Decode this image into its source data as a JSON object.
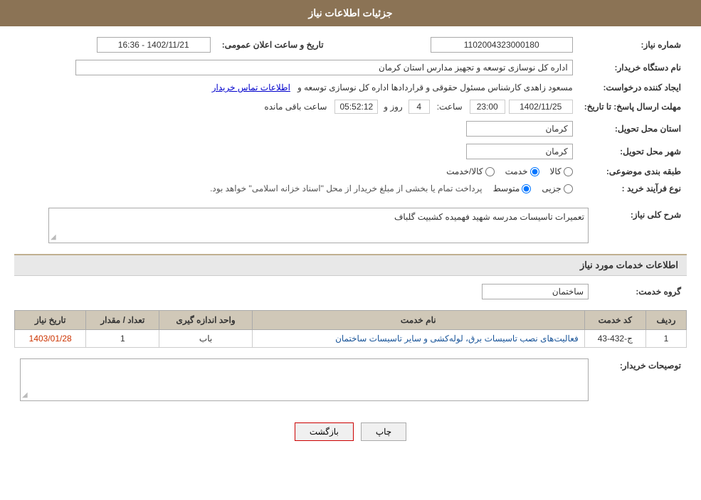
{
  "header": {
    "title": "جزئیات اطلاعات نیاز"
  },
  "fields": {
    "shomareNiaz_label": "شماره نیاز:",
    "shomareNiaz_value": "1102004323000180",
    "namDastgah_label": "نام دستگاه خریدار:",
    "namDastgah_value": "اداره کل نوسازی  توسعه و تجهیز مدارس استان کرمان",
    "ijadKonande_label": "ایجاد کننده درخواست:",
    "ijadKonande_value": "مسعود زاهدی کارشناس مسئول حقوقی و قراردادها اداره کل نوسازی  توسعه و",
    "ijadKonande_link": "اطلاعات تماس خریدار",
    "mohlatErsalPasokh_label": "مهلت ارسال پاسخ: تا تاریخ:",
    "deadline_date": "1402/11/25",
    "deadline_time_label": "ساعت:",
    "deadline_time": "23:00",
    "remaining_label": "روز و",
    "remaining_days": "4",
    "remaining_time": "05:52:12",
    "remaining_suffix": "ساعت باقی مانده",
    "ostanMahal_label": "استان محل تحویل:",
    "ostanMahal_value": "کرمان",
    "shahrMahal_label": "شهر محل تحویل:",
    "shahrMahal_value": "کرمان",
    "tabaqeBandi_label": "طبقه بندی موضوعی:",
    "tabaqeBandi_options": [
      "کالا",
      "خدمت",
      "کالا/خدمت"
    ],
    "tabaqeBandi_selected": "خدمت",
    "noeFarayand_label": "نوع فرآیند خرید :",
    "noeFarayand_options": [
      "جزیی",
      "متوسط"
    ],
    "noeFarayand_selected": "متوسط",
    "noeFarayand_note": "پرداخت تمام یا بخشی از مبلغ خریدار از محل \"اسناد خزانه اسلامی\" خواهد بود.",
    "sharhKoli_label": "شرح کلی نیاز:",
    "sharhKoli_value": "تعمیرات تاسیسات مدرسه شهید فهمیده کشبیت گلباف",
    "serviceInfo_title": "اطلاعات خدمات مورد نیاز",
    "grohKhadamat_label": "گروه خدمت:",
    "grohKhadamat_value": "ساختمان",
    "tarikhElan_label": "تاریخ و ساعت اعلان عمومی:",
    "tarikhElan_value": "1402/11/21 - 16:36"
  },
  "serviceTable": {
    "columns": [
      "ردیف",
      "کد خدمت",
      "نام خدمت",
      "واحد اندازه گیری",
      "تعداد / مقدار",
      "تاریخ نیاز"
    ],
    "rows": [
      {
        "radif": "1",
        "kodKhadamat": "ج-432-43",
        "namKhadamat": "فعالیت‌های نصب تاسیسات برق، لوله‌کشی و سایر تاسیسات ساختمان",
        "vahed": "باب",
        "tedad": "1",
        "tarikh": "1403/01/28"
      }
    ]
  },
  "remarks": {
    "label": "توصیحات خریدار:",
    "value": ""
  },
  "buttons": {
    "print": "چاپ",
    "back": "بازگشت"
  }
}
